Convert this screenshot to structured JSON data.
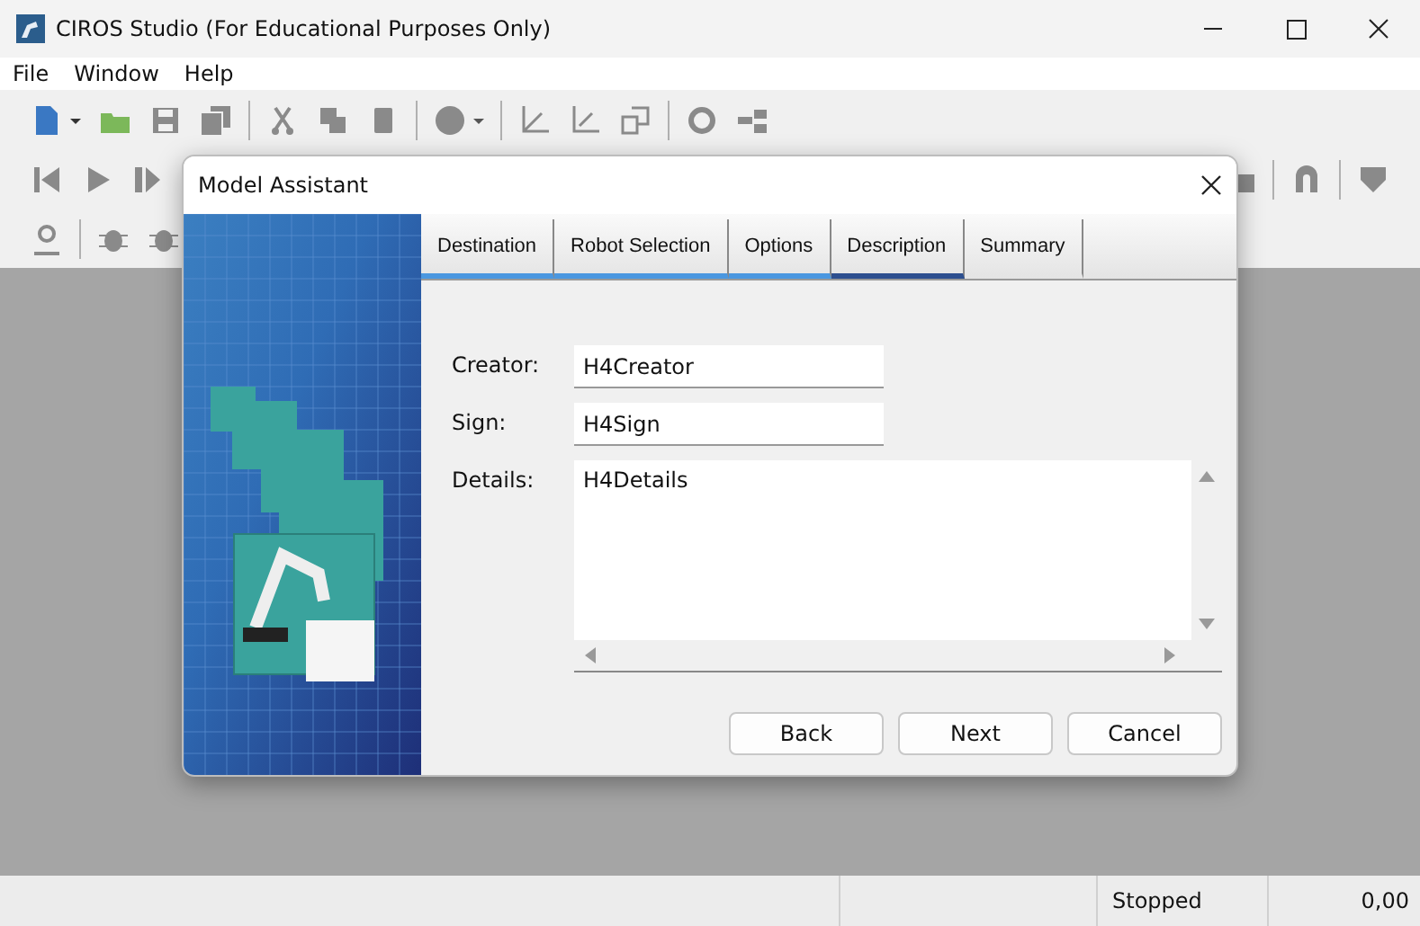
{
  "window": {
    "title": "CIROS Studio (For Educational Purposes Only)"
  },
  "menu": [
    "File",
    "Window",
    "Help"
  ],
  "dialog": {
    "title": "Model Assistant",
    "tabs": [
      {
        "label": "Destination",
        "selected": false,
        "completed": true
      },
      {
        "label": "Robot Selection",
        "selected": false,
        "completed": true
      },
      {
        "label": "Options",
        "selected": false,
        "completed": true
      },
      {
        "label": "Description",
        "selected": true,
        "completed": false
      },
      {
        "label": "Summary",
        "selected": false,
        "completed": false
      }
    ],
    "fields": [
      {
        "label": "Creator:",
        "value": "H4Creator",
        "kind": "line"
      },
      {
        "label": "Sign:",
        "value": "H4Sign",
        "kind": "line"
      },
      {
        "label": "Details:",
        "value": "H4Details",
        "kind": "area"
      }
    ],
    "buttons": [
      "Back",
      "Next",
      "Cancel"
    ]
  },
  "status_bar": {
    "state": "Stopped",
    "value": "0,00"
  }
}
